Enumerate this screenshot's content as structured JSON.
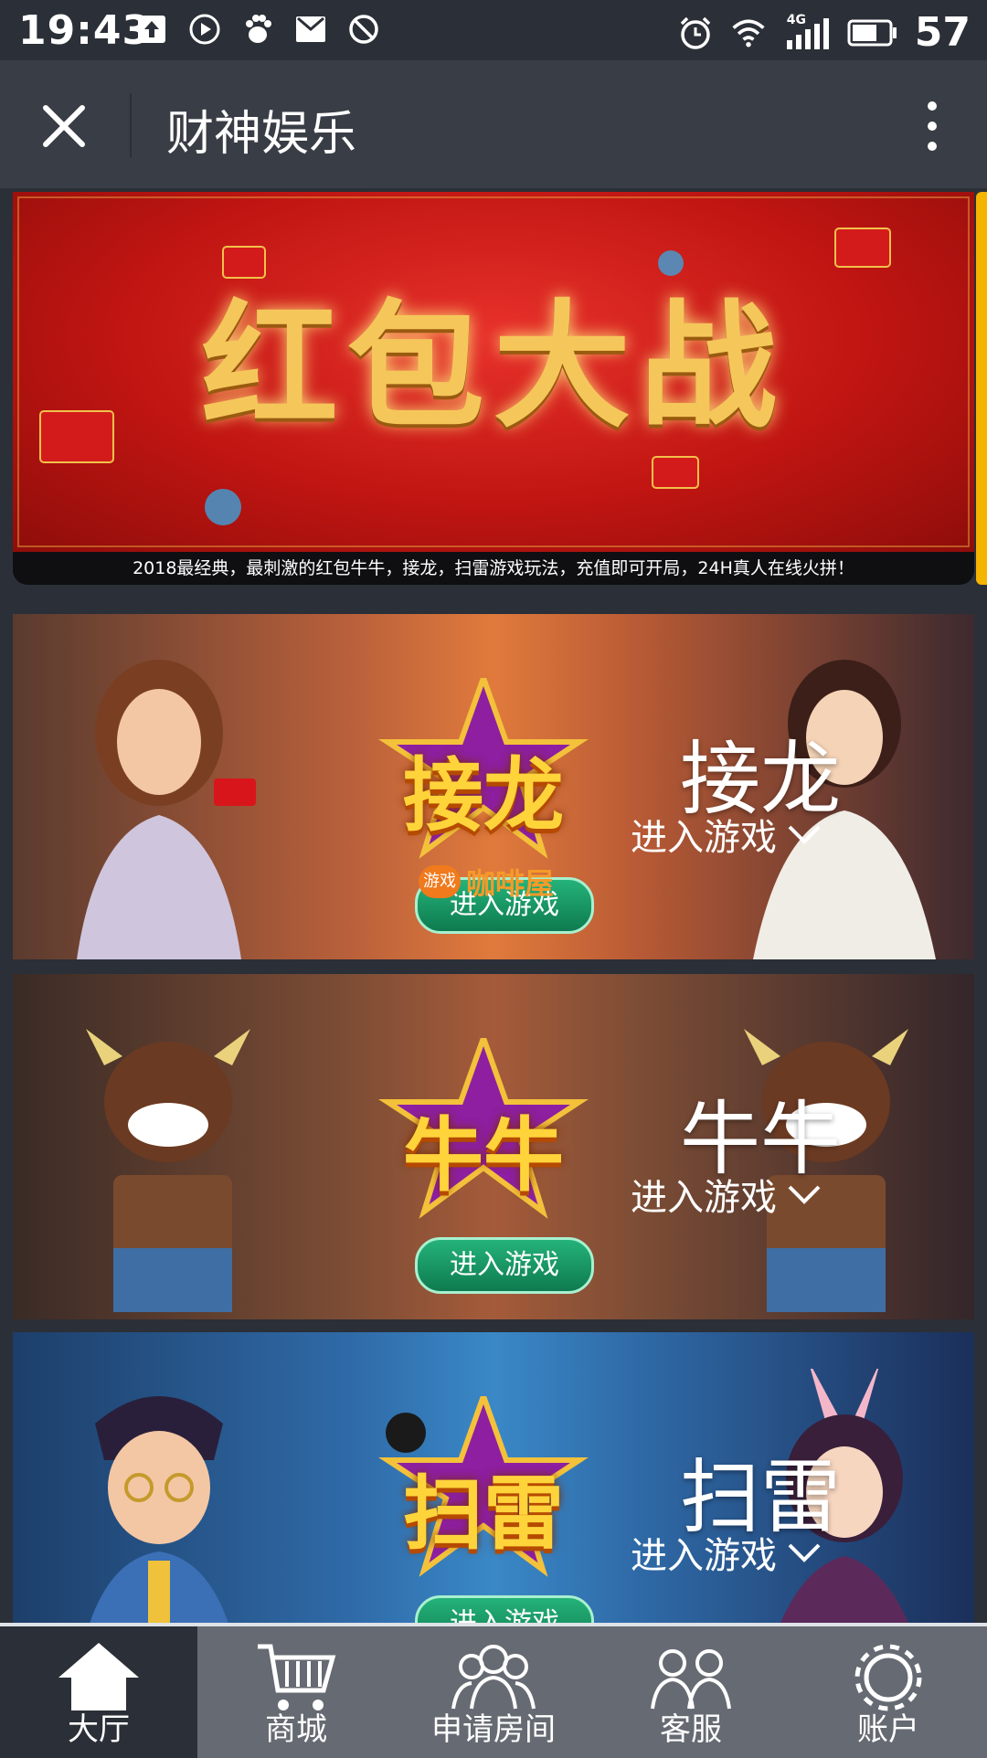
{
  "status_bar": {
    "time": "19:43",
    "network": "4G",
    "battery": "57",
    "left_icons": [
      "upload-icon",
      "play-icon",
      "baidu-icon",
      "mail-icon",
      "block-icon"
    ],
    "right_icons": [
      "alarm-icon",
      "wifi-icon",
      "signal-icon",
      "battery-icon"
    ]
  },
  "header": {
    "title": "财神娱乐",
    "close_icon": "close-icon",
    "more_icon": "more-vertical-icon"
  },
  "banner": {
    "title": "红包大战",
    "caption": "2018最经典，最刺激的红包牛牛，接龙，扫雷游戏玩法，充值即可开局，24H真人在线火拼！"
  },
  "games": [
    {
      "id": "jielong",
      "logo_text": "接龙",
      "name": "接龙",
      "enter_label": "进入游戏",
      "button_label": "进入游戏"
    },
    {
      "id": "niuniu",
      "logo_text": "牛牛",
      "name": "牛牛",
      "enter_label": "进入游戏",
      "button_label": "进入游戏"
    },
    {
      "id": "saolei",
      "logo_text": "扫雷",
      "name": "扫雷",
      "enter_label": "进入游戏",
      "button_label": "进入游戏"
    }
  ],
  "watermark": {
    "badge": "游戏",
    "text": "咖啡屋"
  },
  "nav": [
    {
      "label": "大厅",
      "icon": "home-icon",
      "active": true
    },
    {
      "label": "商城",
      "icon": "cart-icon",
      "active": false
    },
    {
      "label": "申请房间",
      "icon": "group-icon",
      "active": false
    },
    {
      "label": "客服",
      "icon": "support-icon",
      "active": false
    },
    {
      "label": "账户",
      "icon": "gear-icon",
      "active": false
    }
  ],
  "colors": {
    "background": "#2b2f37",
    "header": "#393d45",
    "nav": "#666a72",
    "nav_active": "#2b2f37",
    "accent_yellow": "#f4b400"
  }
}
